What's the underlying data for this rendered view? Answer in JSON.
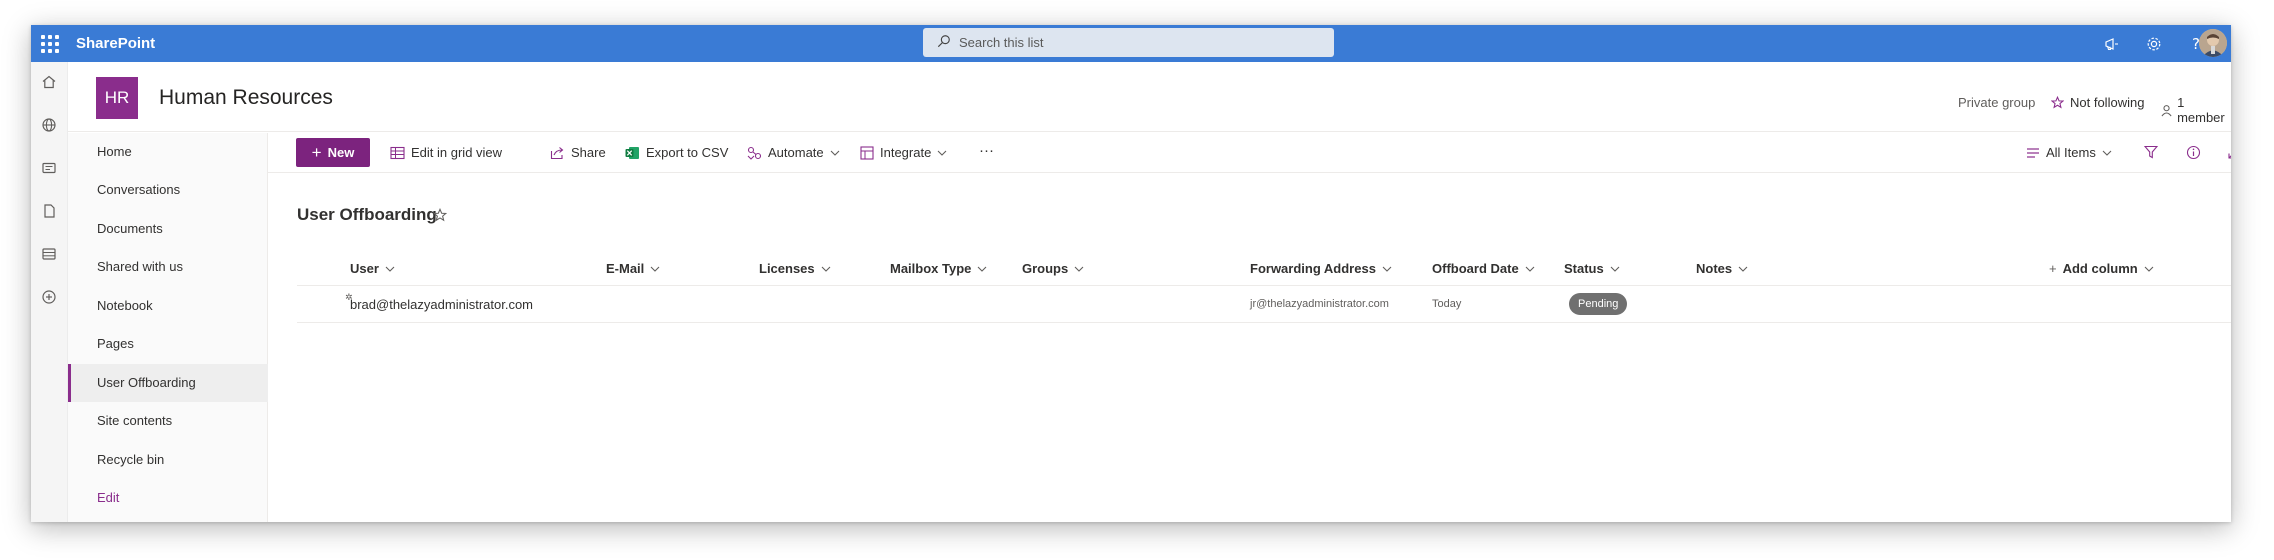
{
  "suitebar": {
    "brand": "SharePoint",
    "search_placeholder": "Search this list",
    "icons": [
      "waffle-icon",
      "megaphone-icon",
      "settings-icon",
      "help-icon",
      "avatar"
    ]
  },
  "rail": {
    "icons": [
      "home-icon",
      "globe-icon",
      "news-icon",
      "document-icon",
      "list-icon",
      "add-icon"
    ]
  },
  "site": {
    "logo_text": "HR",
    "title": "Human Resources",
    "privacy": "Private group",
    "follow_label": "Not following",
    "members_label": "1 member"
  },
  "leftnav": {
    "items": [
      {
        "label": "Home"
      },
      {
        "label": "Conversations"
      },
      {
        "label": "Documents"
      },
      {
        "label": "Shared with us"
      },
      {
        "label": "Notebook"
      },
      {
        "label": "Pages"
      },
      {
        "label": "User Offboarding"
      },
      {
        "label": "Site contents"
      },
      {
        "label": "Recycle bin"
      },
      {
        "label": "Edit"
      }
    ],
    "active": "User Offboarding"
  },
  "commandbar": {
    "new_label": "New",
    "edit_grid_label": "Edit in grid view",
    "share_label": "Share",
    "export_label": "Export to CSV",
    "automate_label": "Automate",
    "integrate_label": "Integrate",
    "more_label": "···",
    "view_label": "All Items"
  },
  "list": {
    "title": "User Offboarding",
    "columns": [
      "User",
      "E-Mail",
      "Licenses",
      "Mailbox Type",
      "Groups",
      "Forwarding Address",
      "Offboard Date",
      "Status",
      "Notes",
      "Add column"
    ],
    "rows": [
      {
        "user": "brad@thelazyadministrator.com",
        "email": "",
        "licenses": "",
        "mailbox_type": "",
        "groups": "",
        "forwarding_address": "jr@thelazyadministrator.com",
        "offboard_date": "Today",
        "status": "Pending",
        "notes": ""
      }
    ]
  },
  "colors": {
    "suitebar": "#3a7bd5",
    "accent": "#8a2d8c",
    "new_button": "#7c237e",
    "status_badge": "#707070"
  }
}
